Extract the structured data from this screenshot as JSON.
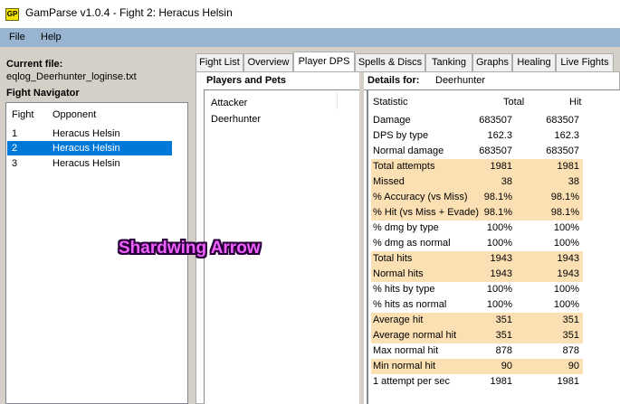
{
  "window": {
    "icon_text": "GP",
    "title": "GamParse v1.0.4 - Fight 2: Heracus Helsin"
  },
  "menu": [
    "File",
    "Help"
  ],
  "left": {
    "current_file_label": "Current file:",
    "current_file": "eqlog_Deerhunter_loginse.txt",
    "fight_navigator_label": "Fight Navigator",
    "columns": [
      "Fight",
      "Opponent"
    ],
    "rows": [
      {
        "fight": "1",
        "opponent": "Heracus Helsin",
        "selected": false
      },
      {
        "fight": "2",
        "opponent": "Heracus Helsin",
        "selected": true
      },
      {
        "fight": "3",
        "opponent": "Heracus Helsin",
        "selected": false
      }
    ]
  },
  "tabs": [
    "Fight List",
    "Overview",
    "Player DPS",
    "Spells & Discs",
    "Tanking",
    "Graphs",
    "Healing",
    "Live Fights"
  ],
  "active_tab": "Player DPS",
  "players_and_pets": {
    "label": "Players and Pets",
    "column": "Attacker",
    "rows": [
      "Deerhunter"
    ]
  },
  "details": {
    "label": "Details for:",
    "name": "Deerhunter",
    "columns": [
      "Statistic",
      "Total",
      "Hit"
    ],
    "rows": [
      {
        "stat": "Damage",
        "total": "683507",
        "hit": "683507",
        "hl": false
      },
      {
        "stat": "DPS by type",
        "total": "162.3",
        "hit": "162.3",
        "hl": false
      },
      {
        "stat": "Normal damage",
        "total": "683507",
        "hit": "683507",
        "hl": false
      },
      {
        "stat": "Total attempts",
        "total": "1981",
        "hit": "1981",
        "hl": true
      },
      {
        "stat": "Missed",
        "total": "38",
        "hit": "38",
        "hl": true
      },
      {
        "stat": "% Accuracy (vs Miss)",
        "total": "98.1%",
        "hit": "98.1%",
        "hl": true
      },
      {
        "stat": "% Hit (vs Miss + Evade)",
        "total": "98.1%",
        "hit": "98.1%",
        "hl": true
      },
      {
        "stat": "% dmg by type",
        "total": "100%",
        "hit": "100%",
        "hl": false
      },
      {
        "stat": "% dmg as normal",
        "total": "100%",
        "hit": "100%",
        "hl": false
      },
      {
        "stat": "Total hits",
        "total": "1943",
        "hit": "1943",
        "hl": true
      },
      {
        "stat": "Normal hits",
        "total": "1943",
        "hit": "1943",
        "hl": true
      },
      {
        "stat": "% hits by type",
        "total": "100%",
        "hit": "100%",
        "hl": false
      },
      {
        "stat": "% hits as normal",
        "total": "100%",
        "hit": "100%",
        "hl": false
      },
      {
        "stat": "Average hit",
        "total": "351",
        "hit": "351",
        "hl": true
      },
      {
        "stat": "Average normal hit",
        "total": "351",
        "hit": "351",
        "hl": true
      },
      {
        "stat": "Max normal hit",
        "total": "878",
        "hit": "878",
        "hl": false
      },
      {
        "stat": "Min normal hit",
        "total": "90",
        "hit": "90",
        "hl": true
      },
      {
        "stat": "1 attempt per sec",
        "total": "1981",
        "hit": "1981",
        "hl": false
      }
    ]
  },
  "overlay_text": "Shardwing Arrow",
  "colors": {
    "highlight_row": "#fbe0b4",
    "selection": "#0078d7",
    "menubar": "#99b4d1",
    "overlay": "#f060ff"
  }
}
